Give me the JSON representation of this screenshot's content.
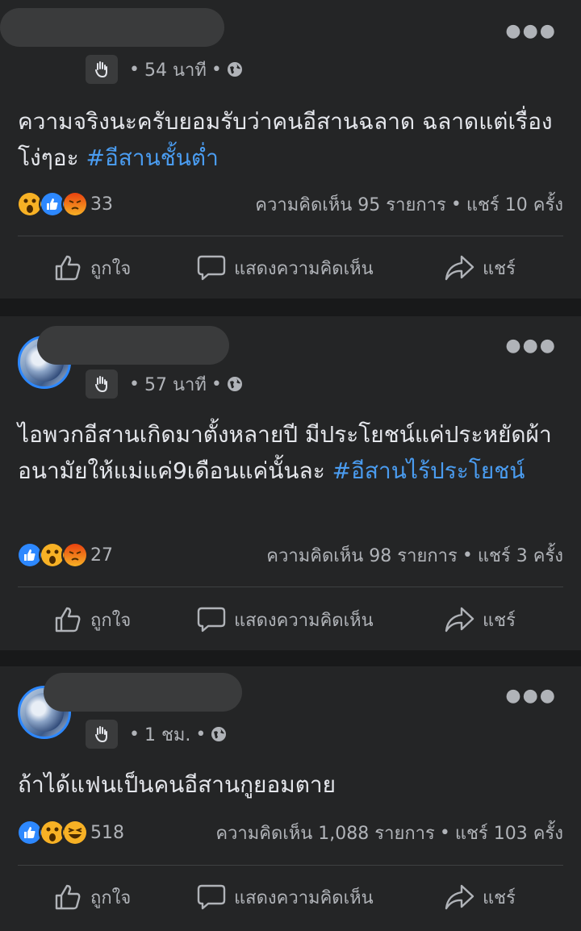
{
  "posts": [
    {
      "time": "54 นาที",
      "text": "ความจริงนะครับยอมรับว่าคนอีสานฉลาด ฉลาดแต่เรื่องโง่ๆอะ ",
      "hashtag": "#อีสานชั้นต่ำ",
      "reaction_count": "33",
      "reactions": [
        "wow",
        "like",
        "angry"
      ],
      "comments": "ความคิดเห็น 95 รายการ",
      "shares": "แชร์ 10 ครั้ง"
    },
    {
      "time": "57 นาที",
      "text": "ไอพวกอีสานเกิดมาตั้งหลายปี มีประโยชน์แค่ประหยัดผ้าอนามัยให้แม่แค่9เดือนแค่นั้นละ ",
      "hashtag": "#อีสานไร้ประโยชน์",
      "reaction_count": "27",
      "reactions": [
        "like",
        "wow",
        "angry"
      ],
      "comments": "ความคิดเห็น 98 รายการ",
      "shares": "แชร์ 3 ครั้ง"
    },
    {
      "time": "1 ชม.",
      "text": "ถ้าได้แฟนเป็นคนอีสานกูยอมตาย",
      "hashtag": "",
      "reaction_count": "518",
      "reactions": [
        "like",
        "wow",
        "haha"
      ],
      "comments": "ความคิดเห็น 1,088 รายการ",
      "shares": "แชร์ 103 ครั้ง"
    }
  ],
  "actions": {
    "like": "ถูกใจ",
    "comment": "แสดงความคิดเห็น",
    "share": "แชร์"
  },
  "icons": {
    "more": "more-dots-icon",
    "audience": "globe-icon",
    "badge": "wave-hand-icon"
  },
  "colors": {
    "background": "#18191a",
    "card": "#242526",
    "hashtag": "#4a9cf0",
    "like": "#2d88ff",
    "wow": "#f7b125",
    "angry": "#e9710f"
  }
}
